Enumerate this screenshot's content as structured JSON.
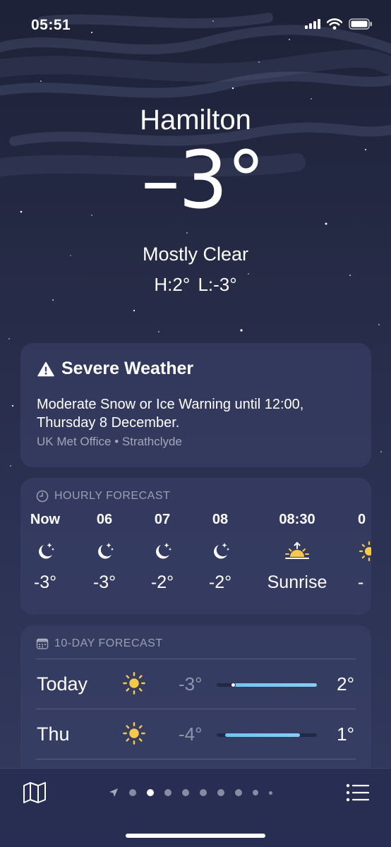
{
  "status_bar": {
    "time": "05:51"
  },
  "header": {
    "city": "Hamilton",
    "temperature": "–3°",
    "condition": "Mostly Clear",
    "hi_lo": "H:2°  L:-3°"
  },
  "severe": {
    "title": "Severe Weather",
    "body": "Moderate Snow or Ice Warning until 12:00, Thursday 8 December.",
    "source": "UK Met Office • Strathclyde"
  },
  "hourly": {
    "heading": "HOURLY FORECAST",
    "items": [
      {
        "label": "Now",
        "icon": "moon-stars-icon",
        "temp": "-3°"
      },
      {
        "label": "06",
        "icon": "moon-stars-icon",
        "temp": "-3°"
      },
      {
        "label": "07",
        "icon": "moon-stars-icon",
        "temp": "-2°"
      },
      {
        "label": "08",
        "icon": "moon-stars-icon",
        "temp": "-2°"
      },
      {
        "label": "08:30",
        "icon": "sunrise-icon",
        "temp": "Sunrise"
      },
      {
        "label": "0",
        "icon": "sun-icon",
        "temp": "-"
      }
    ]
  },
  "ten_day": {
    "heading": "10-DAY FORECAST",
    "range_scale": {
      "min": -4,
      "max": 2
    },
    "days": [
      {
        "day": "Today",
        "icon": "sun-icon",
        "low": "-3°",
        "high": "2°",
        "low_value": -3,
        "high_value": 2,
        "current_value": -3
      },
      {
        "day": "Thu",
        "icon": "sun-icon",
        "low": "-4°",
        "high": "1°",
        "low_value": -3.5,
        "high_value": 1
      }
    ]
  },
  "bottom_bar": {
    "page_count": 9,
    "active_page": 1
  },
  "colors": {
    "accent_bar": "#6fc6f2",
    "sun": "#f7c94b",
    "card_bg": "#3a4068"
  }
}
